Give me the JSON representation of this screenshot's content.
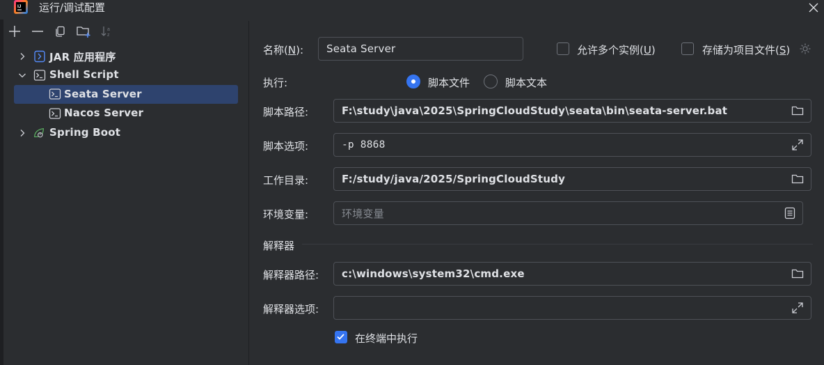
{
  "window": {
    "title": "运行/调试配置"
  },
  "tree": {
    "items": [
      {
        "label": "JAR 应用程序",
        "icon": "jar-app-icon",
        "expanded": false
      },
      {
        "label": "Shell Script",
        "icon": "shell-script-icon",
        "expanded": true
      },
      {
        "label": "Seata Server",
        "icon": "shell-script-icon",
        "selected": true
      },
      {
        "label": "Nacos Server",
        "icon": "shell-script-icon"
      },
      {
        "label": "Spring Boot",
        "icon": "spring-boot-icon",
        "expanded": false
      }
    ]
  },
  "form": {
    "name_label_pre": "名称(",
    "name_label_key": "N",
    "name_label_post": "):",
    "name_value": "Seata Server",
    "allow_multiple_pre": "允许多个实例(",
    "allow_multiple_key": "U",
    "allow_multiple_post": ")",
    "store_as_file_pre": "存储为项目文件(",
    "store_as_file_key": "S",
    "store_as_file_post": ")",
    "execute_label": "执行:",
    "radio_script_file": "脚本文件",
    "radio_script_text": "脚本文本",
    "script_path_label": "脚本路径:",
    "script_path_value": "F:\\study\\java\\2025\\SpringCloudStudy\\seata\\bin\\seata-server.bat",
    "script_options_label": "脚本选项:",
    "script_options_value": "-p 8868",
    "workdir_label": "工作目录:",
    "workdir_value": "F:/study/java/2025/SpringCloudStudy",
    "env_label": "环境变量:",
    "env_placeholder": "环境变量",
    "interpreter_section": "解释器",
    "interpreter_path_label": "解释器路径:",
    "interpreter_path_value": "c:\\windows\\system32\\cmd.exe",
    "interpreter_options_label": "解释器选项:",
    "interpreter_options_value": "",
    "run_in_terminal_label": "在终端中执行"
  },
  "colors": {
    "background": "#2b2d30",
    "accent": "#3574f0",
    "selection": "#2e436e",
    "border": "#4e5157"
  }
}
